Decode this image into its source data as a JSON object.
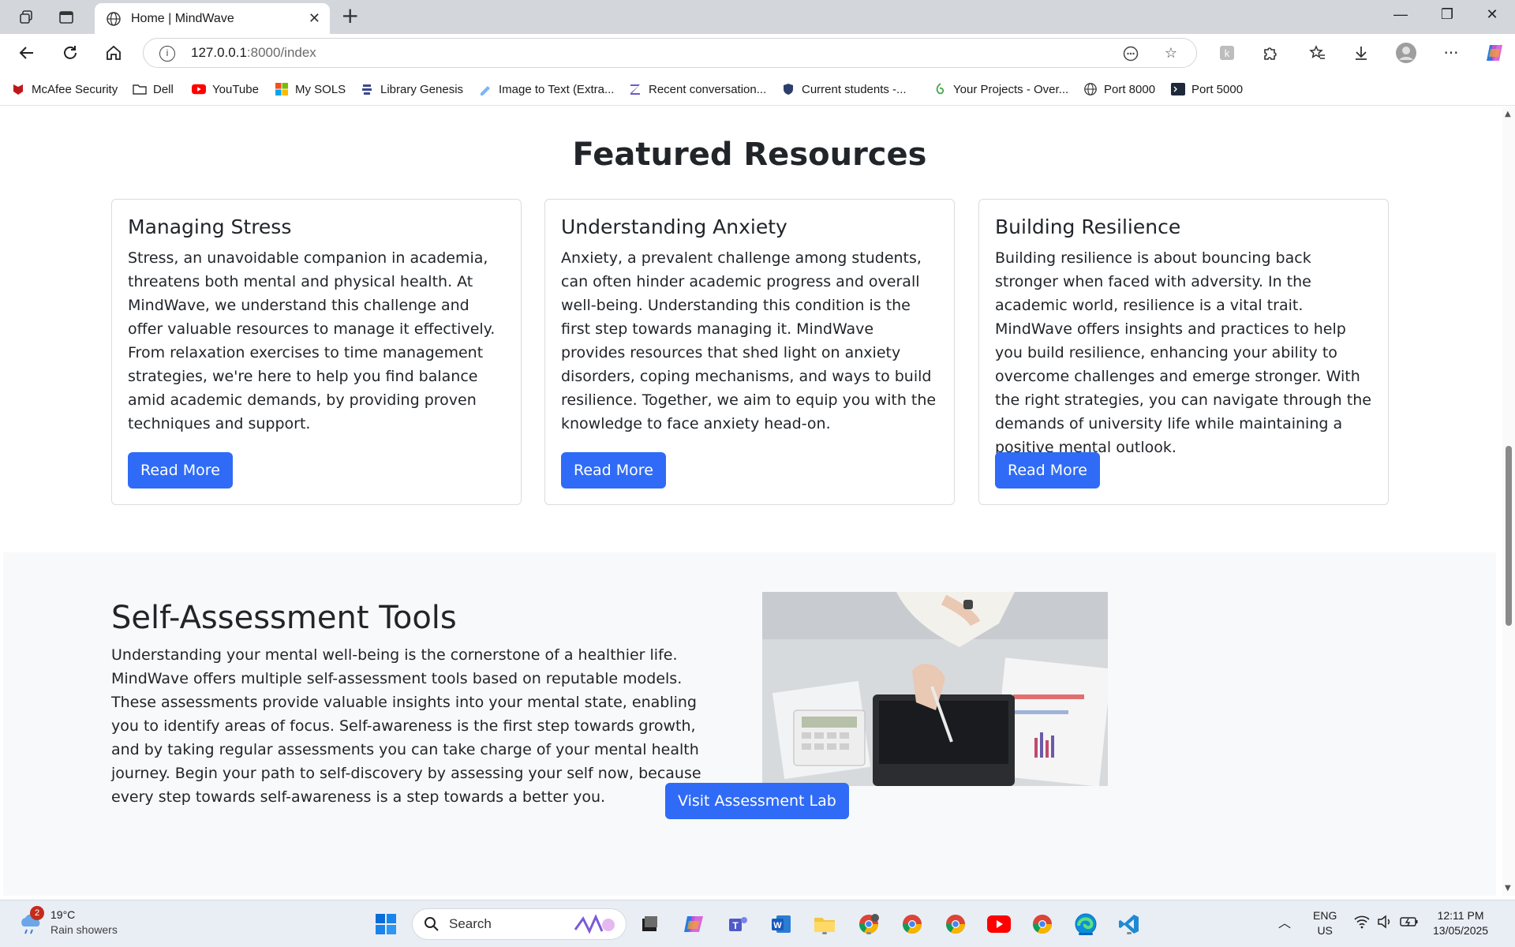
{
  "browser": {
    "tab_title": "Home | MindWave",
    "url_host": "127.0.0.1",
    "url_rest": ":8000/index",
    "bookmarks": [
      {
        "label": "McAfee Security",
        "icon": "mcafee-icon"
      },
      {
        "label": "Dell",
        "icon": "folder-icon"
      },
      {
        "label": "YouTube",
        "icon": "youtube-icon"
      },
      {
        "label": "My SOLS",
        "icon": "microsoft-icon"
      },
      {
        "label": "Library Genesis",
        "icon": "library-icon"
      },
      {
        "label": "Image to Text (Extra...",
        "icon": "image-to-text-icon"
      },
      {
        "label": "Recent conversation...",
        "icon": "z-icon"
      },
      {
        "label": "Current students -...",
        "icon": "shield-icon"
      },
      {
        "label": "Your Projects - Over...",
        "icon": "overleaf-icon"
      },
      {
        "label": "Port 8000",
        "icon": "globe-icon"
      },
      {
        "label": "Port 5000",
        "icon": "terminal-icon"
      }
    ]
  },
  "featured": {
    "title": "Featured Resources",
    "cards": [
      {
        "title": "Managing Stress",
        "text": "Stress, an unavoidable companion in academia, threatens both mental and physical health. At MindWave, we understand this challenge and offer valuable resources to manage it effectively. From relaxation exercises to time management strategies, we're here to help you find balance amid academic demands, by providing proven techniques and support.",
        "button": "Read More"
      },
      {
        "title": "Understanding Anxiety",
        "text": "Anxiety, a prevalent challenge among students, can often hinder academic progress and overall well-being. Understanding this condition is the first step towards managing it. MindWave provides resources that shed light on anxiety disorders, coping mechanisms, and ways to build resilience. Together, we aim to equip you with the knowledge to face anxiety head-on.",
        "button": "Read More"
      },
      {
        "title": "Building Resilience",
        "text": "Building resilience is about bouncing back stronger when faced with adversity. In the academic world, resilience is a vital trait. MindWave offers insights and practices to help you build resilience, enhancing your ability to overcome challenges and emerge stronger. With the right strategies, you can navigate through the demands of university life while maintaining a positive mental outlook.",
        "button": "Read More"
      }
    ]
  },
  "assessment": {
    "title": "Self-Assessment Tools",
    "text": "Understanding your mental well-being is the cornerstone of a healthier life. MindWave offers multiple self-assessment tools based on reputable models. These assessments provide valuable insights into your mental state, enabling you to identify areas of focus. Self-awareness is the first step towards growth, and by taking regular assessments you can take charge of your mental health journey. Begin your path to self-discovery by assessing your self now, because every step towards self-awareness is a step towards a better you.",
    "button": "Visit Assessment Lab"
  },
  "taskbar": {
    "weather_badge": "2",
    "weather_temp": "19°C",
    "weather_desc": "Rain showers",
    "search_placeholder": "Search",
    "lang_top": "ENG",
    "lang_bottom": "US",
    "time": "12:11 PM",
    "date": "13/05/2025"
  },
  "colors": {
    "primary_button": "#2f6bf6",
    "assessment_bg": "#f8f9fa"
  }
}
